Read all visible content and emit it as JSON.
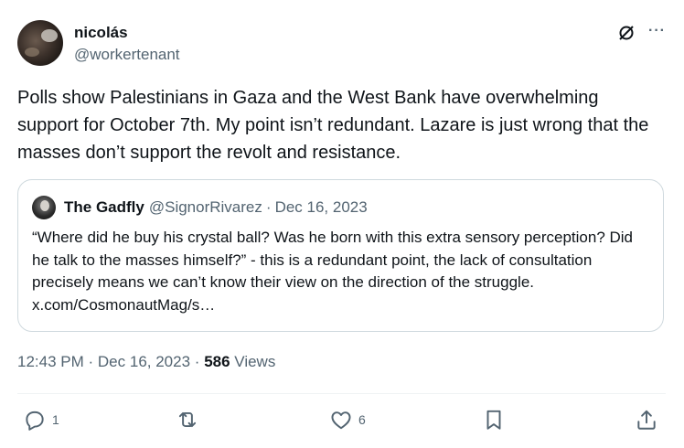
{
  "author": {
    "display_name": "nicolás",
    "handle": "@workertenant"
  },
  "tweet": {
    "text": "Polls show Palestinians in Gaza and the West Bank have overwhelming support for October 7th. My point isn’t redundant. Lazare is just wrong that the masses don’t support the revolt and resistance."
  },
  "quote": {
    "display_name": "The Gadfly",
    "handle": "@SignorRivarez",
    "separator": "·",
    "date": "Dec 16, 2023",
    "text": "“Where did he buy his crystal ball? Was he born with this extra sensory perception? Did he talk to the masses himself?” - this is a redundant point, the lack of consultation precisely means we can’t know their view on the direction of the struggle. x.com/CosmonautMag/s…"
  },
  "meta": {
    "time": "12:43 PM",
    "dot": "·",
    "date": "Dec 16, 2023",
    "views_count": "586",
    "views_label": "Views"
  },
  "actions": {
    "reply_count": "1",
    "repost_count": "",
    "like_count": "6"
  },
  "icons": [
    "grok-icon",
    "more-icon",
    "reply-icon",
    "repost-icon",
    "like-icon",
    "bookmark-icon",
    "share-icon"
  ],
  "colors": {
    "text": "#0f1419",
    "secondary": "#536471",
    "border": "#cfd9de"
  }
}
